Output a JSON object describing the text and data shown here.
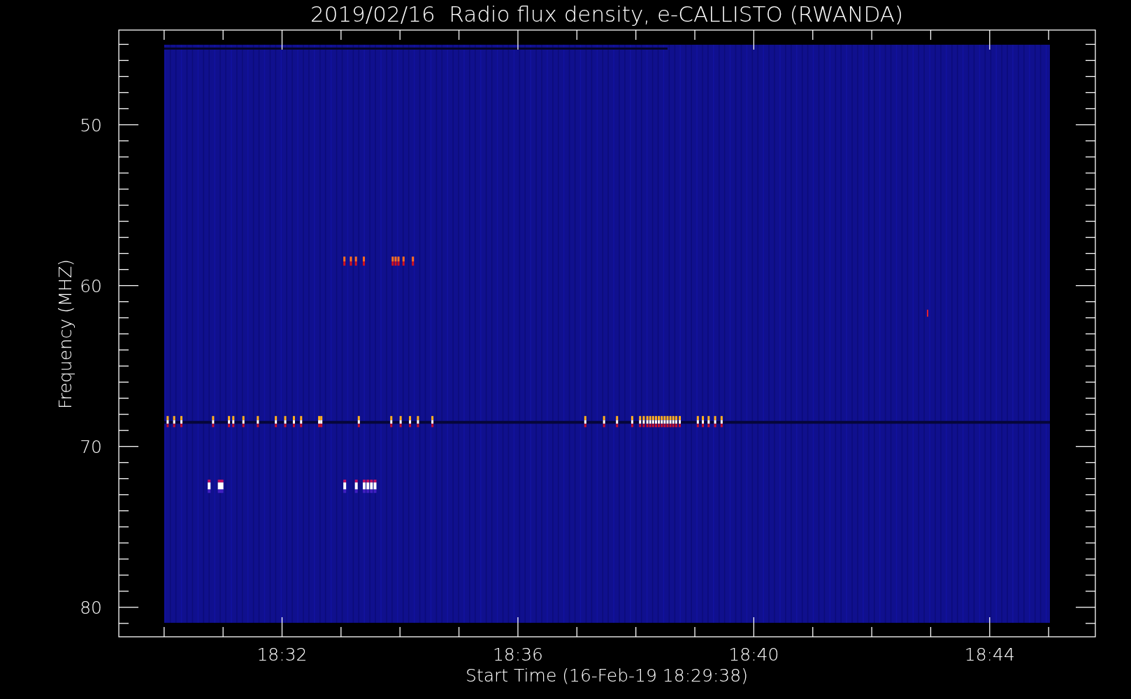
{
  "plot": {
    "title": "2019/02/16  Radio flux density, e-CALLISTO (RWANDA)",
    "y_axis": {
      "label": "Frequency (MHZ)",
      "ticks": [
        "50",
        "60",
        "70",
        "80"
      ]
    },
    "x_axis": {
      "label": "Start Time (16-Feb-19 18:29:38)",
      "ticks": [
        "18:32",
        "18:36",
        "18:40",
        "18:44"
      ]
    }
  }
}
